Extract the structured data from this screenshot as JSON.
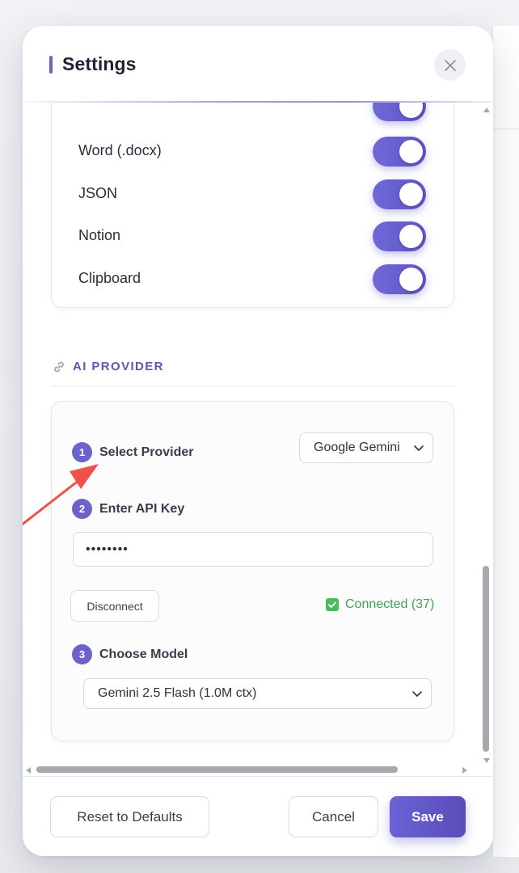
{
  "header": {
    "title": "Settings",
    "close_icon": "close-icon"
  },
  "export_formats": {
    "items": [
      {
        "label": "Word (.docx)",
        "enabled": true
      },
      {
        "label": "JSON",
        "enabled": true
      },
      {
        "label": "Notion",
        "enabled": true
      },
      {
        "label": "Clipboard",
        "enabled": true
      }
    ]
  },
  "ai_provider": {
    "section_title": "AI PROVIDER",
    "section_icon": "link-icon",
    "steps": [
      {
        "number": "1",
        "label": "Select Provider"
      },
      {
        "number": "2",
        "label": "Enter API Key"
      },
      {
        "number": "3",
        "label": "Choose Model"
      }
    ],
    "provider_value": "Google Gemini",
    "api_key_value": "••••••••",
    "disconnect_label": "Disconnect",
    "status_text": "Connected (37)",
    "model_value": "Gemini 2.5 Flash (1.0M ctx)"
  },
  "footer": {
    "reset_label": "Reset to Defaults",
    "cancel_label": "Cancel",
    "save_label": "Save"
  },
  "colors": {
    "accent": "#6b63c9",
    "section_title": "#6a51a6",
    "status_green": "#3fa34d",
    "annotation_arrow": "#f0514a"
  }
}
